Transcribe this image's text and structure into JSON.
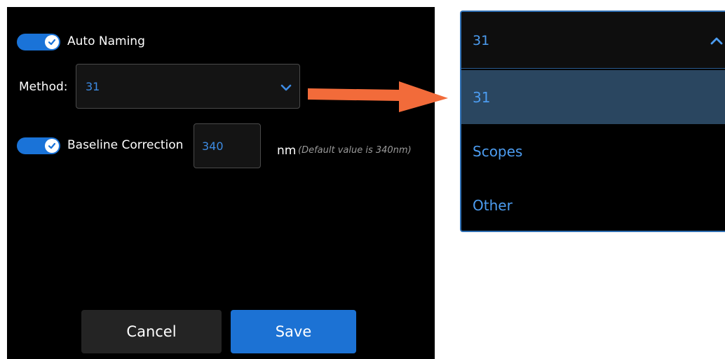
{
  "form": {
    "auto_naming": {
      "label": "Auto Naming",
      "checked": true
    },
    "method": {
      "label": "Method:",
      "value": "31"
    },
    "baseline": {
      "label": "Baseline Correction",
      "checked": true,
      "value": "340",
      "unit": "nm",
      "hint": "(Default value is 340nm)"
    },
    "buttons": {
      "cancel": "Cancel",
      "save": "Save"
    }
  },
  "dropdown": {
    "selected": "31",
    "options": [
      "31",
      "Scopes",
      "Other"
    ],
    "selected_index": 0
  },
  "colors": {
    "accent": "#1a73d8",
    "option_text": "#4c9cf0",
    "arrow": "#f26b3a",
    "selected_bg": "#2a4660"
  },
  "icons": [
    "check-icon",
    "chevron-down-icon",
    "chevron-up-icon",
    "arrow-right-icon"
  ]
}
